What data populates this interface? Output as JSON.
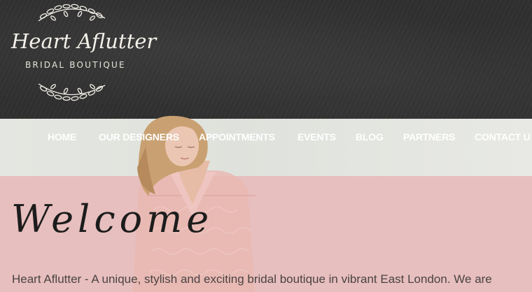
{
  "header": {
    "logo_title": "Heart Aflutter",
    "logo_subtitle": "BRIDAL BOUTIQUE"
  },
  "nav": {
    "items": [
      {
        "label": "HOME"
      },
      {
        "label": "OUR DESIGNERS"
      },
      {
        "label": "APPOINTMENTS"
      },
      {
        "label": "EVENTS"
      },
      {
        "label": "BLOG"
      },
      {
        "label": "PARTNERS"
      },
      {
        "label": "CONTACT U"
      }
    ]
  },
  "main": {
    "heading": "Welcome",
    "intro": "Heart Aflutter - A unique, stylish and exciting bridal boutique in vibrant East London. We are"
  },
  "colors": {
    "chalkboard": "#2f2f2f",
    "pink": "#e7bfbe",
    "nav_text": "#ffffff"
  },
  "icons": [
    "laurel-wreath-icon"
  ]
}
